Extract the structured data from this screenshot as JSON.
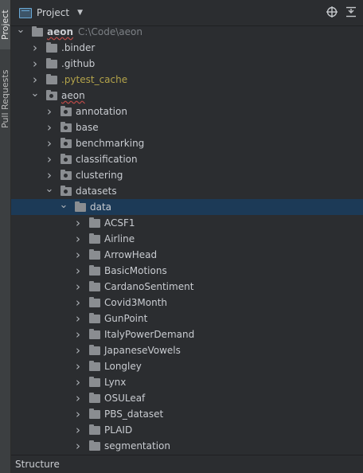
{
  "side_tabs": {
    "project": "Project",
    "pull_requests": "Pull Requests"
  },
  "header": {
    "title": "Project"
  },
  "tree": [
    {
      "label": "aeon",
      "path": "C:\\Code\\aeon",
      "depth": 0,
      "expanded": true,
      "bold": true,
      "underline": true,
      "type": "folder"
    },
    {
      "label": ".binder",
      "depth": 1,
      "expanded": false,
      "type": "folder"
    },
    {
      "label": ".github",
      "depth": 1,
      "expanded": false,
      "type": "folder"
    },
    {
      "label": ".pytest_cache",
      "depth": 1,
      "expanded": false,
      "excluded": true,
      "type": "folder"
    },
    {
      "label": "aeon",
      "depth": 1,
      "expanded": true,
      "underline": true,
      "type": "pkg"
    },
    {
      "label": "annotation",
      "depth": 2,
      "expanded": false,
      "type": "pkg"
    },
    {
      "label": "base",
      "depth": 2,
      "expanded": false,
      "type": "pkg"
    },
    {
      "label": "benchmarking",
      "depth": 2,
      "expanded": false,
      "type": "pkg"
    },
    {
      "label": "classification",
      "depth": 2,
      "expanded": false,
      "type": "pkg"
    },
    {
      "label": "clustering",
      "depth": 2,
      "expanded": false,
      "type": "pkg"
    },
    {
      "label": "datasets",
      "depth": 2,
      "expanded": true,
      "type": "pkg"
    },
    {
      "label": "data",
      "depth": 3,
      "expanded": true,
      "selected": true,
      "type": "folder"
    },
    {
      "label": "ACSF1",
      "depth": 4,
      "expanded": false,
      "type": "folder"
    },
    {
      "label": "Airline",
      "depth": 4,
      "expanded": false,
      "type": "folder"
    },
    {
      "label": "ArrowHead",
      "depth": 4,
      "expanded": false,
      "type": "folder"
    },
    {
      "label": "BasicMotions",
      "depth": 4,
      "expanded": false,
      "type": "folder"
    },
    {
      "label": "CardanoSentiment",
      "depth": 4,
      "expanded": false,
      "type": "folder"
    },
    {
      "label": "Covid3Month",
      "depth": 4,
      "expanded": false,
      "type": "folder"
    },
    {
      "label": "GunPoint",
      "depth": 4,
      "expanded": false,
      "type": "folder"
    },
    {
      "label": "ItalyPowerDemand",
      "depth": 4,
      "expanded": false,
      "type": "folder"
    },
    {
      "label": "JapaneseVowels",
      "depth": 4,
      "expanded": false,
      "type": "folder"
    },
    {
      "label": "Longley",
      "depth": 4,
      "expanded": false,
      "type": "folder"
    },
    {
      "label": "Lynx",
      "depth": 4,
      "expanded": false,
      "type": "folder"
    },
    {
      "label": "OSULeaf",
      "depth": 4,
      "expanded": false,
      "type": "folder"
    },
    {
      "label": "PBS_dataset",
      "depth": 4,
      "expanded": false,
      "type": "folder"
    },
    {
      "label": "PLAID",
      "depth": 4,
      "expanded": false,
      "type": "folder"
    },
    {
      "label": "segmentation",
      "depth": 4,
      "expanded": false,
      "type": "folder"
    }
  ],
  "footer": {
    "label": "Structure"
  },
  "icons": {
    "header_caret": "chevron-down-icon",
    "locate": "crosshair-icon",
    "collapse": "collapse-all-icon"
  },
  "colors": {
    "selection": "#1c3a57",
    "excluded": "#b3a34a"
  }
}
